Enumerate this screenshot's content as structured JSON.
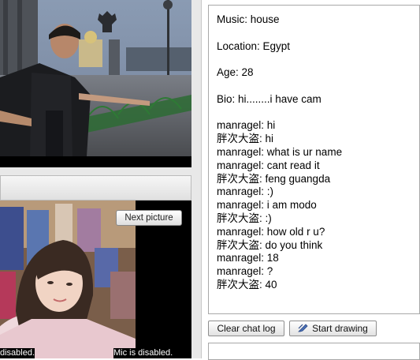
{
  "profile": {
    "music": "Music: house",
    "location": "Location: Egypt",
    "age": "Age: 28",
    "bio": "Bio: hi........i have cam"
  },
  "chat": {
    "messages": [
      "manragel: hi",
      "胖次大盗: hi",
      "manragel: what is ur name",
      "manragel: cant read it",
      "胖次大盗: feng guangda",
      "manragel: :)",
      "manragel: i am modo",
      "胖次大盗: :)",
      "manragel: how old r u?",
      "胖次大盗: do you think",
      "manragel: 18",
      "manragel: ?",
      "胖次大盗: 40"
    ]
  },
  "buttons": {
    "clear_chat": "Clear chat log",
    "start_drawing": "Start drawing",
    "next_picture": "Next picture"
  },
  "video": {
    "cam_disabled": "disabled.",
    "mic_disabled": "Mic is disabled."
  },
  "colors": {
    "panel_bg": "#e8e8e8",
    "border": "#a8a8a8",
    "video_bg": "#000000"
  }
}
